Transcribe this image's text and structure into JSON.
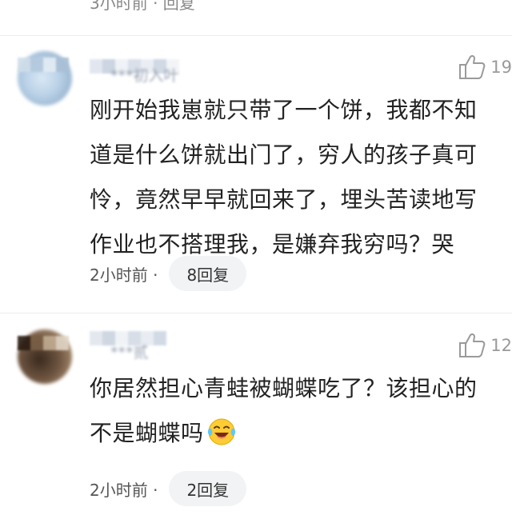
{
  "previous_comment": {
    "meta": "3小时前 · 回复"
  },
  "comments": [
    {
      "username": "***初入叶",
      "likes": "19",
      "lines": [
        "刚开始我崽就只带了一个饼，我都不知",
        "道是什么饼就出门了，穷人的孩子真可",
        "怜，竟然早早就回来了，埋头苦读地写",
        "作业也不搭理我，是嫌弃我穷吗？哭"
      ],
      "time": "2小时前 ·",
      "reply": "8回复"
    },
    {
      "username": "***贰",
      "likes": "12",
      "lines": [
        "你居然担心青蛙被蝴蝶吃了？该担心的",
        "不是蝴蝶吗"
      ],
      "emoji": "laughing-crying-emoji",
      "time": "2小时前 ·",
      "reply": "2回复"
    }
  ],
  "colors": {
    "text": "#222222",
    "meta": "#888888",
    "pill_bg": "#f2f3f5",
    "like": "#9a9a9a"
  },
  "icons": [
    "thumbs-up-icon",
    "laughing-crying-emoji"
  ]
}
